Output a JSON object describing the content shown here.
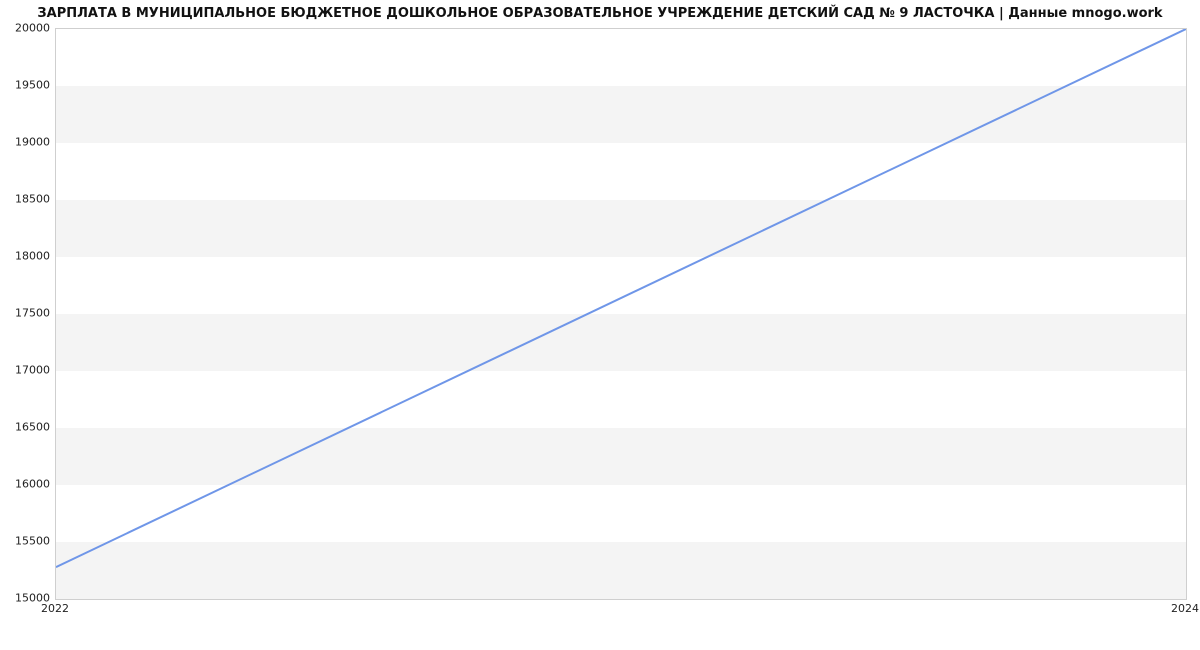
{
  "chart_data": {
    "type": "line",
    "title": "ЗАРПЛАТА В МУНИЦИПАЛЬНОЕ БЮДЖЕТНОЕ ДОШКОЛЬНОЕ ОБРАЗОВАТЕЛЬНОЕ УЧРЕЖДЕНИЕ ДЕТСКИЙ САД № 9 ЛАСТОЧКА | Данные mnogo.work",
    "xlabel": "",
    "ylabel": "",
    "x": [
      2022,
      2024
    ],
    "values": [
      15280,
      20000
    ],
    "xlim": [
      2022,
      2024
    ],
    "ylim": [
      15000,
      20000
    ],
    "yticks": [
      15000,
      15500,
      16000,
      16500,
      17000,
      17500,
      18000,
      18500,
      19000,
      19500,
      20000
    ],
    "xticks": [
      2022,
      2024
    ],
    "line_color": "#6f96e8",
    "plot_bg": "#f4f4f4",
    "band_bg": "#ffffff"
  }
}
